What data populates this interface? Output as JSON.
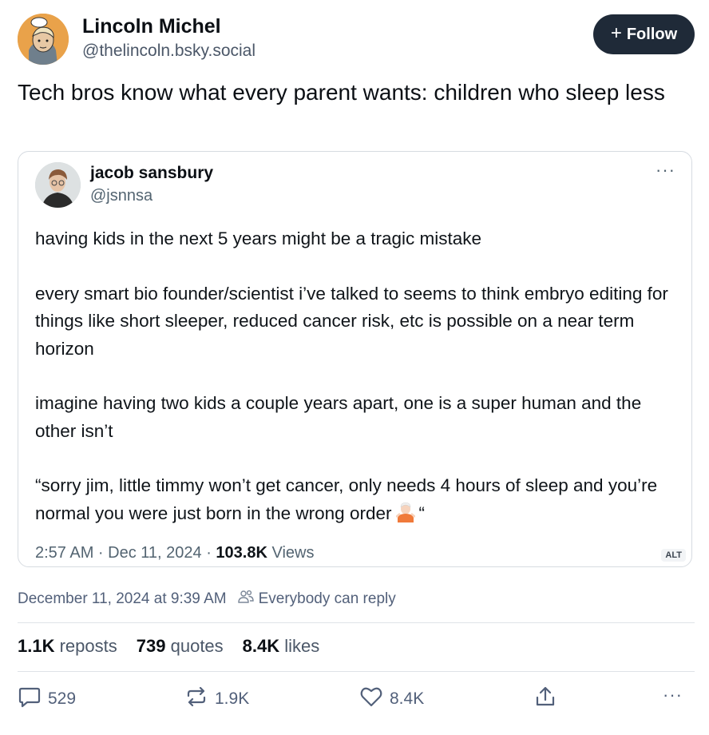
{
  "author": {
    "name": "Lincoln Michel",
    "handle": "@thelincoln.bsky.social",
    "follow_label": "Follow"
  },
  "post": {
    "text": "Tech bros know what every parent wants: children who sleep less"
  },
  "quote": {
    "name": "jacob sansbury",
    "handle": "@jsnnsa",
    "more": "···",
    "paragraphs": [
      "having kids in the next 5 years might be a tragic mistake",
      "every smart bio founder/scientist i’ve talked to seems to think embryo editing for things like short sleeper, reduced cancer risk, etc is possible on a near term horizon",
      "imagine having two kids a couple years apart, one is a super human and the other isn’t",
      "“sorry jim, little timmy won’t get cancer, only needs 4 hours of sleep and you’re normal you were just born in the wrong order"
    ],
    "closing_quote": "“",
    "meta_time": "2:57 AM · Dec 11, 2024 · ",
    "views_count": "103.8K",
    "views_label": "Views",
    "alt_badge": "ALT"
  },
  "post_meta": {
    "date": "December 11, 2024 at 9:39 AM",
    "reply_setting": "Everybody can reply"
  },
  "stats": {
    "reposts_count": "1.1K",
    "reposts_label": "reposts",
    "quotes_count": "739",
    "quotes_label": "quotes",
    "likes_count": "8.4K",
    "likes_label": "likes"
  },
  "actions": {
    "reply_count": "529",
    "repost_count": "1.9K",
    "like_count": "8.4K",
    "more": "···"
  },
  "icons": {
    "reply": "speech-bubble-icon",
    "repost": "repost-arrows-icon",
    "like": "heart-icon",
    "share": "share-icon",
    "people": "people-icon"
  },
  "colors": {
    "follow_bg": "#1f2a38",
    "muted_text": "#52607a",
    "divider": "#dfe3e8"
  }
}
